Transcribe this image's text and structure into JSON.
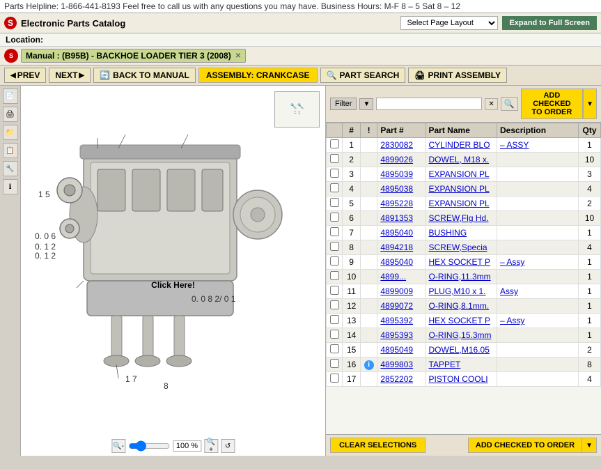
{
  "helpline": {
    "text": "Parts Helpline: 1-866-441-8193 Feel free to call us with any questions you may have. Business Hours: M-F 8 – 5 Sat 8 – 12"
  },
  "header": {
    "app_title": "Electronic Parts Catalog",
    "layout_placeholder": "Select Page Layout",
    "expand_btn": "Expand to Full Screen",
    "logo": "S"
  },
  "location": {
    "label": "Location:"
  },
  "tab": {
    "label": "Manual : (B95B) - BACKHOE LOADER TIER 3 (2008)"
  },
  "toolbar": {
    "prev": "PREV",
    "next": "NEXT",
    "back_to_manual": "BACK TO MANUAL",
    "assembly": "ASSEMBLY: CRANKCASE",
    "part_search": "PART SEARCH",
    "print_assembly": "PRINT ASSEMBLY"
  },
  "filter": {
    "label": "Filter",
    "dropdown_char": "▼",
    "clear_char": "✕",
    "search_char": "🔍",
    "add_to_order": "ADD CHECKED TO ORDER",
    "add_dropdown": "▼"
  },
  "table": {
    "headers": [
      "",
      "#",
      "!",
      "Part #",
      "Part Name",
      "Description",
      "Qty"
    ],
    "rows": [
      {
        "num": "1",
        "warn": "",
        "part": "2830082",
        "name": "CYLINDER BLO",
        "desc": "– ASSY",
        "qty": "1"
      },
      {
        "num": "2",
        "warn": "",
        "part": "4899026",
        "name": "DOWEL, M18 x.",
        "desc": "",
        "qty": "10"
      },
      {
        "num": "3",
        "warn": "",
        "part": "4895039",
        "name": "EXPANSION PL",
        "desc": "",
        "qty": "3"
      },
      {
        "num": "4",
        "warn": "",
        "part": "4895038",
        "name": "EXPANSION PL",
        "desc": "",
        "qty": "4"
      },
      {
        "num": "5",
        "warn": "",
        "part": "4895228",
        "name": "EXPANSION PL",
        "desc": "",
        "qty": "2"
      },
      {
        "num": "6",
        "warn": "",
        "part": "4891353",
        "name": "SCREW,Flg Hd.",
        "desc": "",
        "qty": "10"
      },
      {
        "num": "7",
        "warn": "",
        "part": "4895040",
        "name": "BUSHING",
        "desc": "",
        "qty": "1"
      },
      {
        "num": "8",
        "warn": "",
        "part": "4894218",
        "name": "SCREW,Specia",
        "desc": "",
        "qty": "4"
      },
      {
        "num": "9",
        "warn": "",
        "part": "4895040",
        "name": "HEX SOCKET P",
        "desc": "– Assy",
        "qty": "1"
      },
      {
        "num": "10",
        "warn": "",
        "part": "4899...",
        "name": "O-RING,11.3mm",
        "desc": "",
        "qty": "1"
      },
      {
        "num": "11",
        "warn": "",
        "part": "4899009",
        "name": "PLUG,M10 x 1.",
        "desc": "Assy",
        "qty": "1"
      },
      {
        "num": "12",
        "warn": "",
        "part": "4899072",
        "name": "O-RING,8.1mm.",
        "desc": "",
        "qty": "1"
      },
      {
        "num": "13",
        "warn": "",
        "part": "4895392",
        "name": "HEX SOCKET P",
        "desc": "– Assy",
        "qty": "1"
      },
      {
        "num": "14",
        "warn": "",
        "part": "4895393",
        "name": "O-RING,15.3mm",
        "desc": "",
        "qty": "1"
      },
      {
        "num": "15",
        "warn": "",
        "part": "4895049",
        "name": "DOWEL,M16.05",
        "desc": "",
        "qty": "2"
      },
      {
        "num": "16",
        "warn": "info",
        "part": "4899803",
        "name": "TAPPET",
        "desc": "",
        "qty": "8"
      },
      {
        "num": "17",
        "warn": "",
        "part": "2852202",
        "name": "PISTON COOLI",
        "desc": "",
        "qty": "4"
      }
    ]
  },
  "bottom": {
    "clear_btn": "CLEAR SELECTIONS",
    "add_order_btn": "ADD CHECKED TO ORDER",
    "add_dropdown": "▼"
  },
  "diagram": {
    "zoom_level": "100 %",
    "click_overlay": "Click Here!"
  },
  "sidebar": {
    "icons": [
      "📄",
      "🖨",
      "📁",
      "📋",
      "🔧",
      "ℹ"
    ]
  }
}
